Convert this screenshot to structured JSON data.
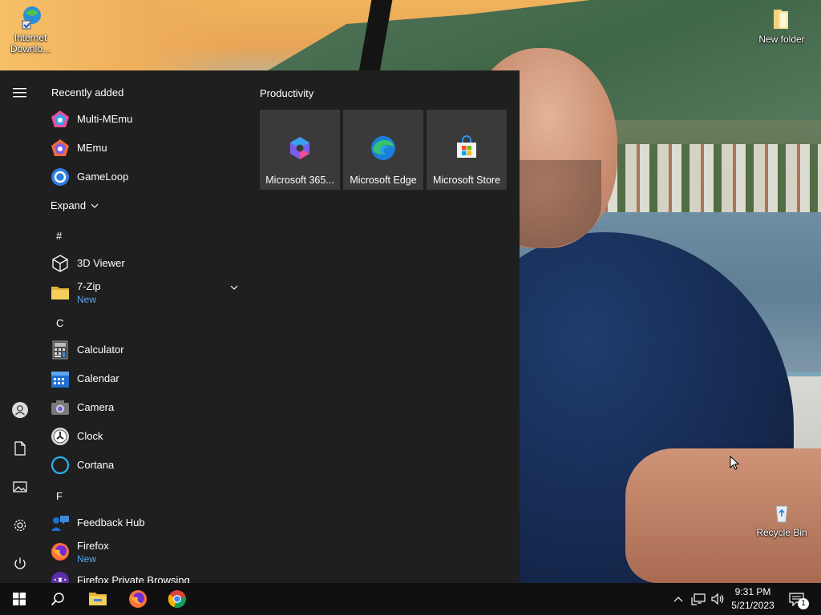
{
  "desktop": {
    "icons": [
      {
        "label": "Internet Downlo..."
      },
      {
        "label": "New folder"
      },
      {
        "label": "Recycle Bin"
      }
    ]
  },
  "start_menu": {
    "recently_added_title": "Recently added",
    "recent_apps": [
      {
        "label": "Multi-MEmu",
        "icon": "multi-memu-icon"
      },
      {
        "label": "MEmu",
        "icon": "memu-icon"
      },
      {
        "label": "GameLoop",
        "icon": "gameloop-icon"
      }
    ],
    "expand_label": "Expand",
    "groups": [
      {
        "letter": "#",
        "apps": [
          {
            "label": "3D Viewer",
            "icon": "3d-viewer-icon"
          },
          {
            "label": "7-Zip",
            "sub": "New",
            "icon": "folder-icon"
          }
        ]
      },
      {
        "letter": "C",
        "apps": [
          {
            "label": "Calculator",
            "icon": "calculator-icon"
          },
          {
            "label": "Calendar",
            "icon": "calendar-icon"
          },
          {
            "label": "Camera",
            "icon": "camera-icon"
          },
          {
            "label": "Clock",
            "icon": "clock-icon"
          },
          {
            "label": "Cortana",
            "icon": "cortana-icon"
          }
        ]
      },
      {
        "letter": "F",
        "apps": [
          {
            "label": "Feedback Hub",
            "icon": "feedback-hub-icon"
          },
          {
            "label": "Firefox",
            "sub": "New",
            "icon": "firefox-icon"
          },
          {
            "label": "Firefox Private Browsing",
            "icon": "firefox-private-icon"
          }
        ]
      }
    ],
    "tiles_group_title": "Productivity",
    "tiles": [
      {
        "label": "Microsoft 365...",
        "icon": "microsoft-365-icon"
      },
      {
        "label": "Microsoft Edge",
        "icon": "edge-icon"
      },
      {
        "label": "Microsoft Store",
        "icon": "store-icon"
      }
    ]
  },
  "taskbar": {
    "time": "9:31 PM",
    "date": "5/21/2023",
    "notification_count": "1"
  },
  "colors": {
    "start_bg": "#1f1f1f",
    "tile_bg": "#3a3a3a",
    "taskbar_bg": "#101010",
    "accent_new": "#5aa7f2"
  }
}
